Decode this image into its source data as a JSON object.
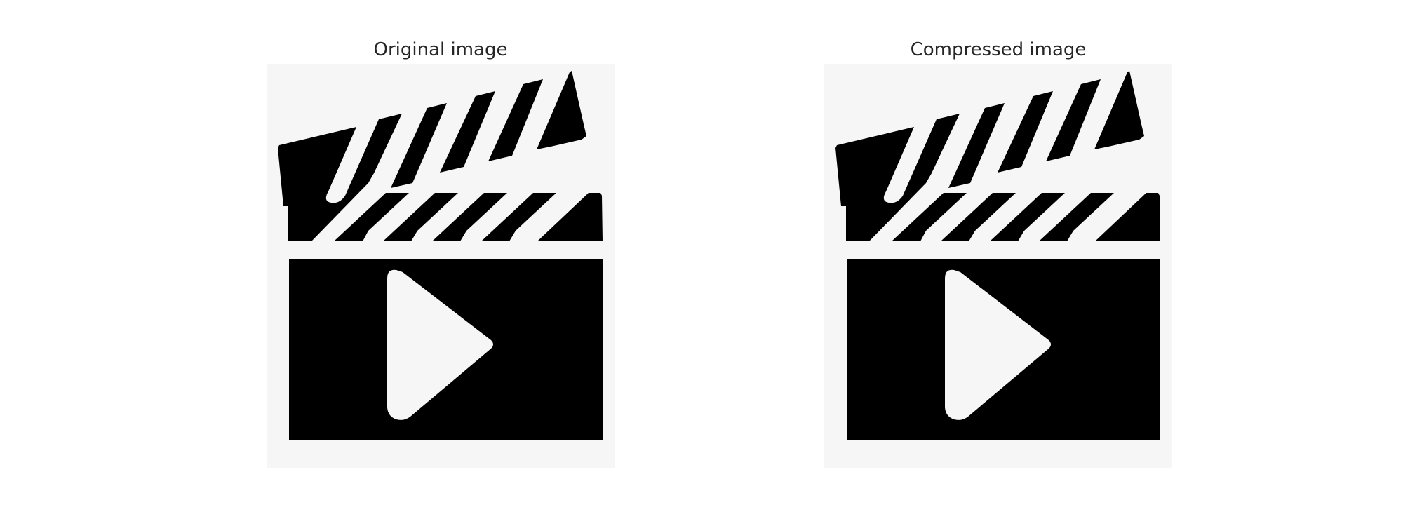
{
  "panels": [
    {
      "title": "Original image",
      "icon": "clapperboard-play-icon"
    },
    {
      "title": "Compressed image",
      "icon": "clapperboard-play-icon"
    }
  ],
  "colors": {
    "background": "#ffffff",
    "image_background": "#f6f6f6",
    "icon": "#000000",
    "title_text": "#262626"
  }
}
